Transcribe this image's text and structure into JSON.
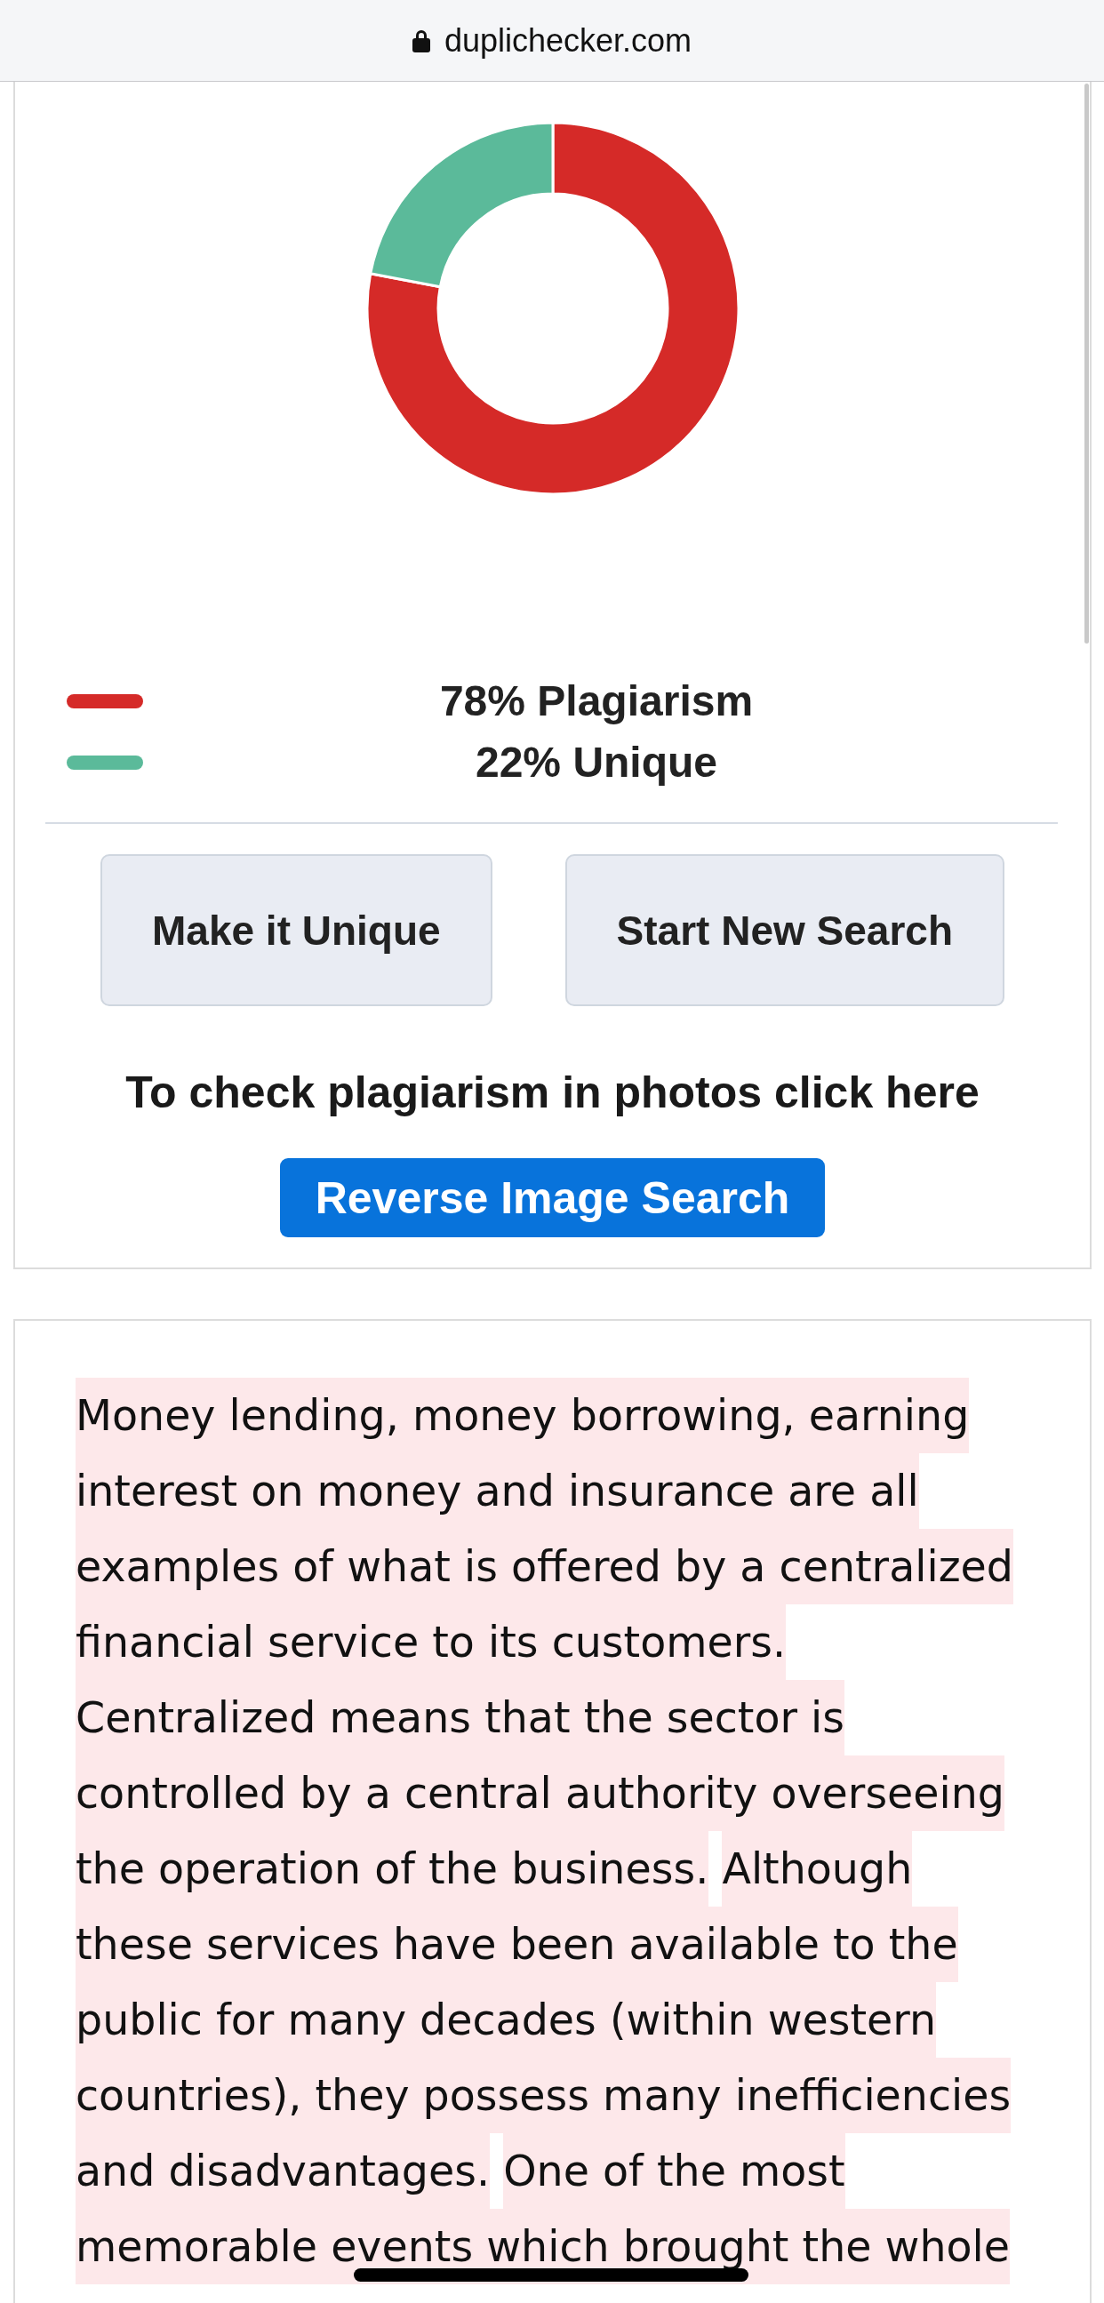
{
  "browser": {
    "url": "duplichecker.com",
    "secure": true
  },
  "result": {
    "chart_data": {
      "type": "donut",
      "values": [
        78,
        22
      ]
    },
    "legend": [
      {
        "label": "78% Plagiarism",
        "color": "#d52a28"
      },
      {
        "label": "22% Unique",
        "color": "#5bba9a"
      }
    ],
    "buttons": [
      "Make it Unique",
      "Start New Search"
    ],
    "photo_prompt": "To check plagiarism in photos click here",
    "reverse_search_button": "Reverse Image Search"
  },
  "checked_text": {
    "sentences": [
      {
        "text": "Money lending, money borrowing, earning interest on money and insurance are all examples of what is offered by a centralized financial service to its customers.",
        "highlighted": true
      },
      {
        "text": "Centralized means that the sector is controlled by a central authority overseeing the operation of the business.",
        "highlighted": true
      },
      {
        "text": "Although these services have been available to the public for many decades (within western countries), they possess many inefficiencies and disadvantages.",
        "highlighted": true
      },
      {
        "text": "One of the most memorable events which brought the whole",
        "highlighted": true
      }
    ]
  }
}
